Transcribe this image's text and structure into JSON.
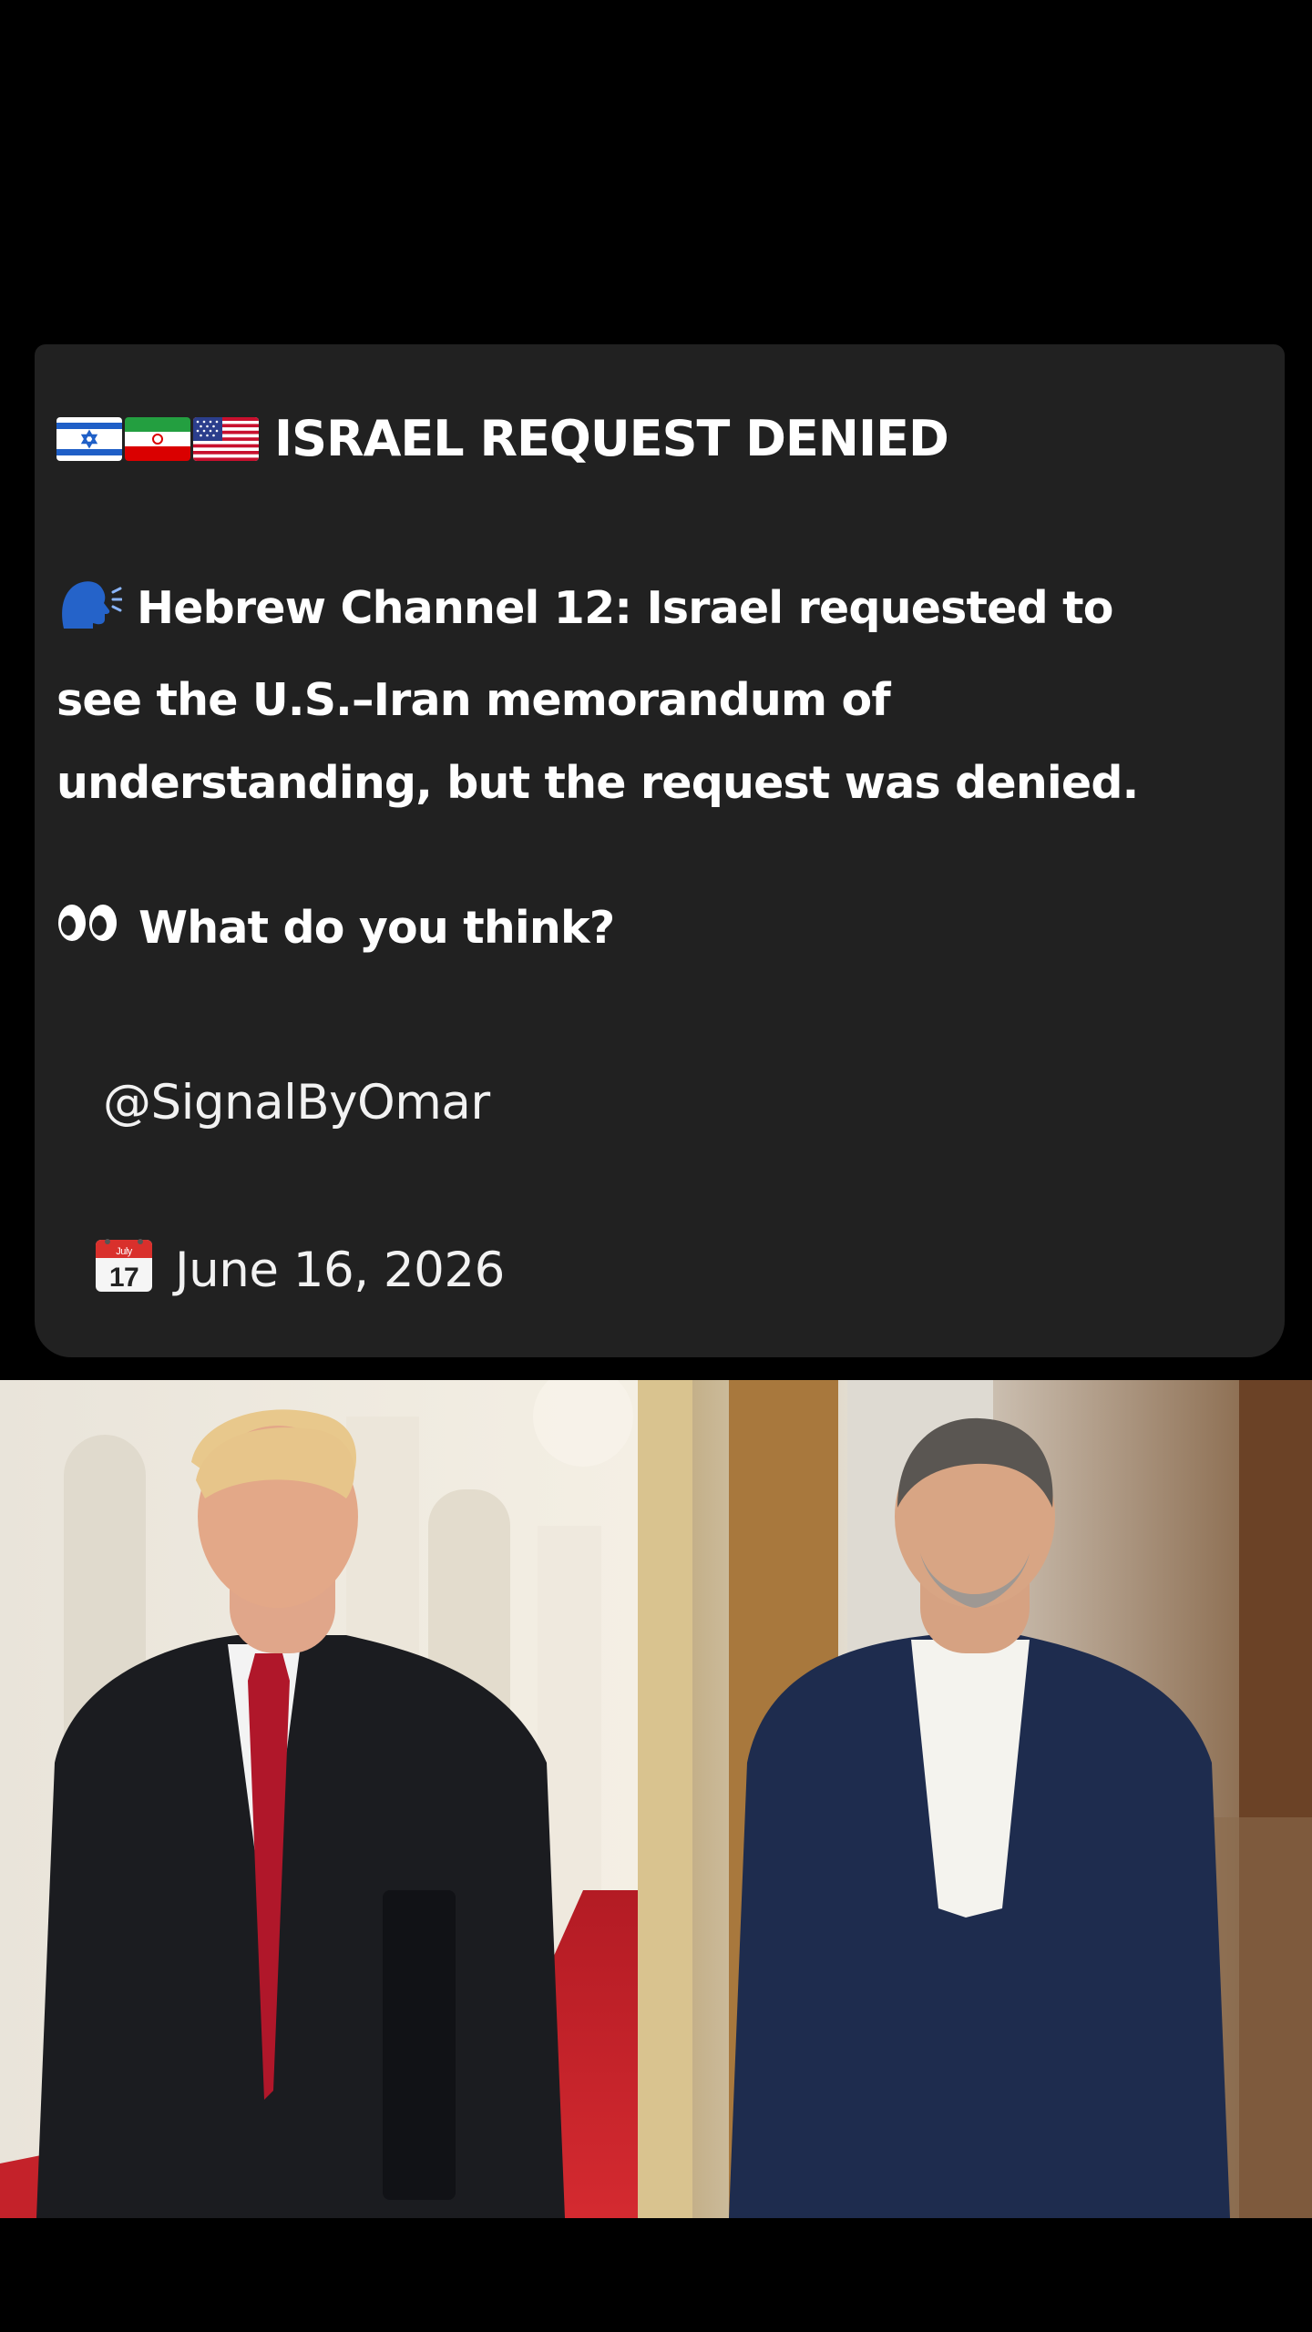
{
  "post": {
    "headline": "ISRAEL REQUEST DENIED",
    "flags": [
      "israel-flag-icon",
      "iran-flag-icon",
      "us-flag-icon"
    ],
    "body_icon": "speaking-head-icon",
    "body": "Hebrew Channel 12: Israel requested to see the U.S.–Iran memorandum of understanding, but the request was denied.",
    "question_icon": "eyes-icon",
    "question": "What do you think?",
    "handle": "@SignalByOmar",
    "date_icon": "calendar-icon",
    "calendar_month": "July",
    "calendar_day": "17",
    "date": "June 16, 2026"
  },
  "colors": {
    "background": "#000000",
    "card": "#212121",
    "text": "#ffffff"
  },
  "image": {
    "description_icon": "photo-two-men-walking"
  }
}
